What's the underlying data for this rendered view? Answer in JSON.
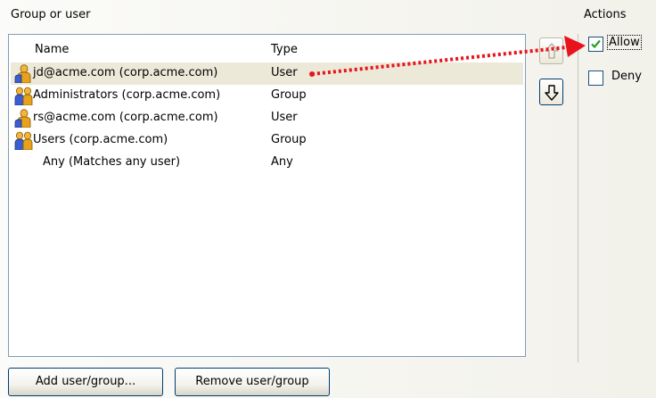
{
  "group_label": "Group or user",
  "actions_label": "Actions",
  "columns": {
    "name": "Name",
    "type": "Type"
  },
  "rows": [
    {
      "name": "jd@acme.com (corp.acme.com)",
      "type": "User",
      "icon": "single-user-icon",
      "selected": true
    },
    {
      "name": "Administrators (corp.acme.com)",
      "type": "Group",
      "icon": "group-users-icon",
      "selected": false
    },
    {
      "name": "rs@acme.com (corp.acme.com)",
      "type": "User",
      "icon": "single-user-icon",
      "selected": false
    },
    {
      "name": "Users  (corp.acme.com)",
      "type": "Group",
      "icon": "group-users-icon",
      "selected": false
    },
    {
      "name": "Any (Matches any user)",
      "type": "Any",
      "icon": "",
      "selected": false
    }
  ],
  "actions": {
    "allow": {
      "label": "Allow",
      "checked": true
    },
    "deny": {
      "label": "Deny",
      "checked": false
    }
  },
  "buttons": {
    "add": "Add user/group...",
    "remove": "Remove user/group",
    "move_up": "up-arrow-icon",
    "move_down": "down-arrow-icon"
  },
  "colors": {
    "selection": "#ece9d8",
    "annotation_arrow": "#e8141c",
    "list_border": "#7f9db9"
  }
}
